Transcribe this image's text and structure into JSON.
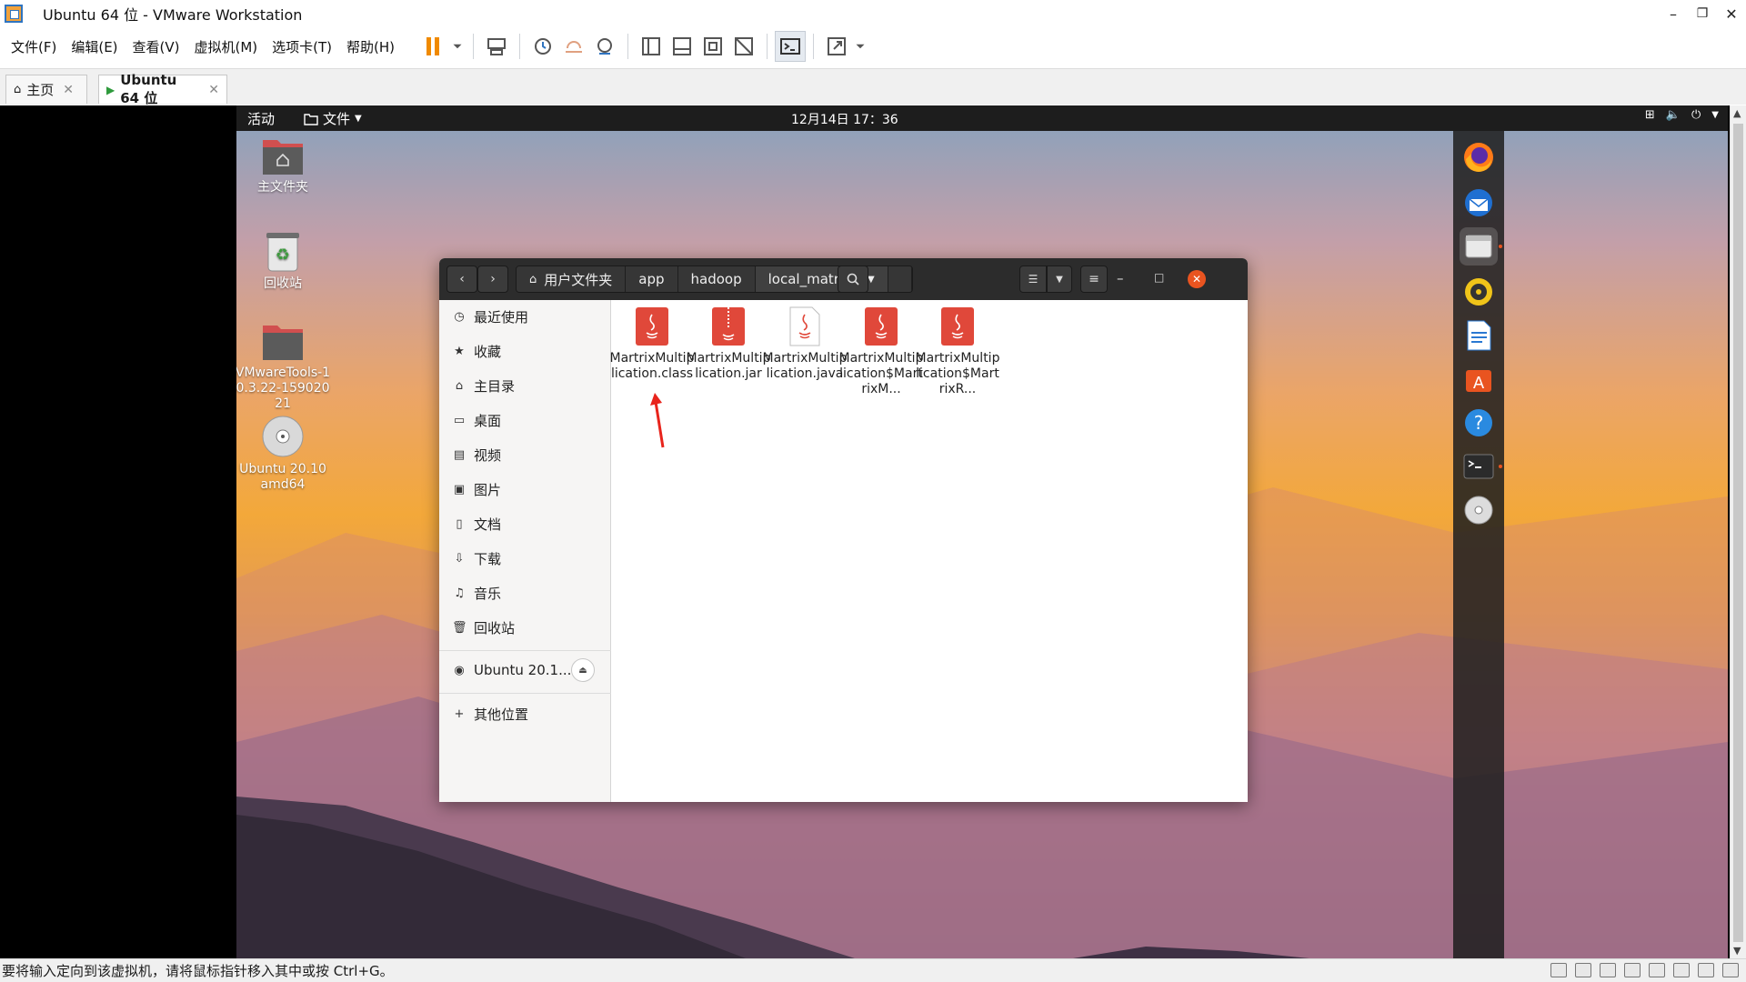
{
  "window": {
    "title": "Ubuntu 64 位 - VMware Workstation",
    "minimize": "–",
    "restore": "❐",
    "close": "✕"
  },
  "menu": [
    "文件(F)",
    "编辑(E)",
    "查看(V)",
    "虚拟机(M)",
    "选项卡(T)",
    "帮助(H)"
  ],
  "tabs": [
    {
      "label": "主页",
      "close": "✕"
    },
    {
      "label": "Ubuntu 64 位",
      "close": "✕"
    }
  ],
  "status": {
    "message": "要将输入定向到该虚拟机，请将鼠标指针移入其中或按 Ctrl+G。"
  },
  "ubuntu": {
    "topbar": {
      "activities": "活动",
      "app_menu": "文件",
      "clock": "12月14日  17：36"
    },
    "desktop_icons": [
      {
        "label": "主文件夹"
      },
      {
        "label": "回收站"
      },
      {
        "label": "VMwareTools-10.3.22-15902021"
      },
      {
        "label": "Ubuntu 20.10 amd64"
      }
    ],
    "dock": [
      "firefox",
      "thunderbird",
      "files",
      "rhythmbox",
      "libreoffice-writer",
      "software",
      "help",
      "terminal",
      "cdrom"
    ],
    "files_window": {
      "path": [
        "用户文件夹",
        "app",
        "hadoop",
        "local_matrix"
      ],
      "sidebar": [
        {
          "label": "最近使用",
          "icon": "clock-icon"
        },
        {
          "label": "收藏",
          "icon": "star-icon"
        },
        {
          "label": "主目录",
          "icon": "home-icon"
        },
        {
          "label": "桌面",
          "icon": "desktop-icon"
        },
        {
          "label": "视频",
          "icon": "video-icon"
        },
        {
          "label": "图片",
          "icon": "image-icon"
        },
        {
          "label": "文档",
          "icon": "document-icon"
        },
        {
          "label": "下载",
          "icon": "download-icon"
        },
        {
          "label": "音乐",
          "icon": "music-icon"
        },
        {
          "label": "回收站",
          "icon": "trash-icon"
        }
      ],
      "device": "Ubuntu 20.1...",
      "other_locations": "其他位置",
      "files": [
        {
          "name": "MartrixMultiplication.class"
        },
        {
          "name": "MartrixMultiplication.jar"
        },
        {
          "name": "MartrixMultiplication.java"
        },
        {
          "name": "MartrixMultiplication$MartrixM..."
        },
        {
          "name": "MartrixMultiplication$MartrixR..."
        }
      ]
    }
  },
  "colors": {
    "ubuntu_orange": "#e95420",
    "java_red": "#e0483a",
    "header_dark": "#2c2c2c"
  }
}
